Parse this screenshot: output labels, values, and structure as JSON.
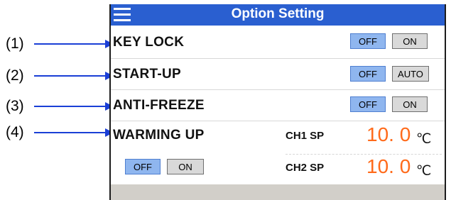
{
  "header": {
    "title": "Option Setting",
    "menu_icon": "hamburger-menu-icon"
  },
  "callouts": [
    "(1)",
    "(2)",
    "(3)",
    "(4)"
  ],
  "rows": {
    "key_lock": {
      "label": "KEY LOCK",
      "off": "OFF",
      "on": "ON",
      "selected": "OFF"
    },
    "start_up": {
      "label": "START-UP",
      "off": "OFF",
      "auto": "AUTO",
      "selected": "OFF"
    },
    "anti_freeze": {
      "label": "ANTI-FREEZE",
      "off": "OFF",
      "on": "ON",
      "selected": "OFF"
    },
    "warming_up": {
      "label": "WARMING UP",
      "off": "OFF",
      "on": "ON",
      "selected": "OFF",
      "ch1": {
        "label": "CH1 SP",
        "value": "10. 0",
        "unit": "℃"
      },
      "ch2": {
        "label": "CH2 SP",
        "value": "10. 0",
        "unit": "℃"
      }
    }
  },
  "colors": {
    "title_bar": "#2a5fd0",
    "selected_button": "#8fb6ef",
    "setpoint_value": "#ff6a1a",
    "callout_arrow": "#1a3fd6"
  }
}
